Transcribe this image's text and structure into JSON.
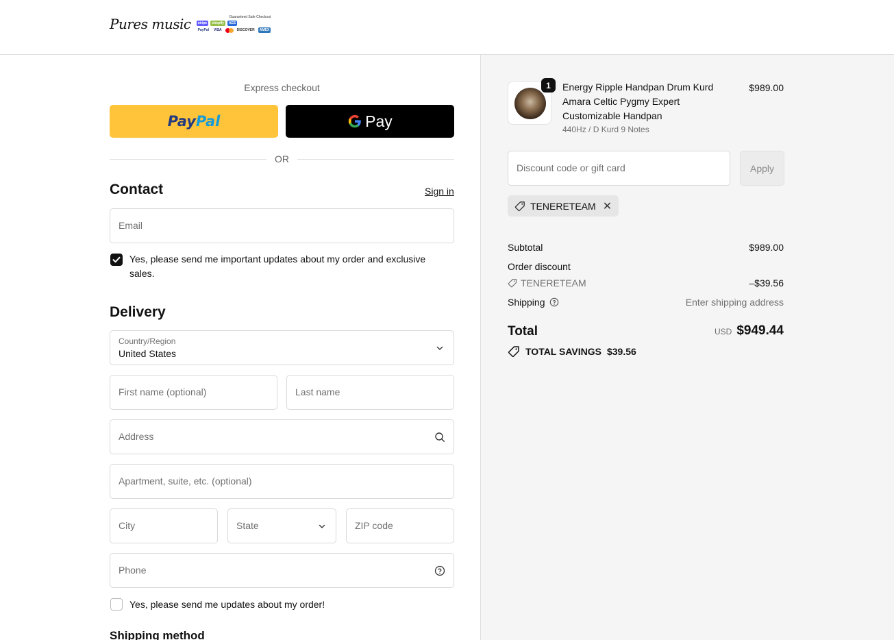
{
  "brand": {
    "name": "Pures music",
    "badge_title": "Guaranteed Safe Checkout",
    "badges_row1": [
      "stripe",
      "shopify",
      "AES"
    ],
    "badges_row2": [
      "PayPal",
      "VISA",
      "DISCOVER",
      "AMEX"
    ]
  },
  "express": {
    "label": "Express checkout",
    "paypal_part1": "Pay",
    "paypal_part2": "Pal",
    "gpay_g": "G",
    "gpay_label": "Pay",
    "or": "OR"
  },
  "contact": {
    "title": "Contact",
    "sign_in": "Sign in",
    "email_placeholder": "Email",
    "updates_checkbox_label": "Yes, please send me important updates about my order and exclusive sales.",
    "updates_checked": true
  },
  "delivery": {
    "title": "Delivery",
    "country_label": "Country/Region",
    "country_value": "United States",
    "first_name_placeholder": "First name (optional)",
    "last_name_placeholder": "Last name",
    "address_placeholder": "Address",
    "apartment_placeholder": "Apartment, suite, etc. (optional)",
    "city_placeholder": "City",
    "state_placeholder": "State",
    "zip_placeholder": "ZIP code",
    "phone_placeholder": "Phone",
    "sms_checkbox_label": "Yes, please send me updates about my order!",
    "sms_checked": false
  },
  "shipping_method": {
    "title": "Shipping method"
  },
  "summary": {
    "product": {
      "quantity": "1",
      "title": "Energy Ripple Handpan Drum Kurd Amara Celtic Pygmy Expert Customizable Handpan",
      "variant": "440Hz / D Kurd 9 Notes",
      "price": "$989.00"
    },
    "discount_placeholder": "Discount code or gift card",
    "apply_label": "Apply",
    "applied_code": "TENERETEAM",
    "subtotal_label": "Subtotal",
    "subtotal_value": "$989.00",
    "order_discount_label": "Order discount",
    "discount_code": "TENERETEAM",
    "discount_value": "–$39.56",
    "shipping_label": "Shipping",
    "shipping_value": "Enter shipping address",
    "total_label": "Total",
    "currency": "USD",
    "total_value": "$949.44",
    "savings_label": "TOTAL SAVINGS",
    "savings_value": "$39.56"
  }
}
